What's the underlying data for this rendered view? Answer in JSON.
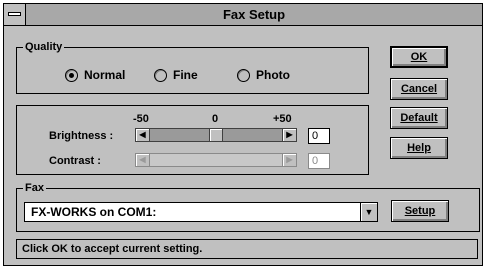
{
  "window": {
    "title": "Fax Setup"
  },
  "quality": {
    "label": "Quality",
    "options": [
      {
        "label": "Normal",
        "selected": true
      },
      {
        "label": "Fine",
        "selected": false
      },
      {
        "label": "Photo",
        "selected": false
      }
    ]
  },
  "buttons": {
    "ok": "OK",
    "cancel": "Cancel",
    "default": "Default",
    "help": "Help",
    "setup": "Setup"
  },
  "adjust": {
    "ticks": {
      "min": "-50",
      "mid": "0",
      "max": "+50"
    },
    "brightness": {
      "label": "Brightness :",
      "value": "0",
      "enabled": true
    },
    "contrast": {
      "label": "Contrast :",
      "value": "0",
      "enabled": false
    }
  },
  "fax": {
    "label": "Fax",
    "device": "FX-WORKS on COM1:"
  },
  "status": {
    "text": "Click OK to accept current setting."
  },
  "icons": {
    "system_menu": "system-menu-icon",
    "left": "scroll-left-arrow-icon",
    "right": "scroll-right-arrow-icon",
    "dropdown": "dropdown-arrow-icon"
  }
}
